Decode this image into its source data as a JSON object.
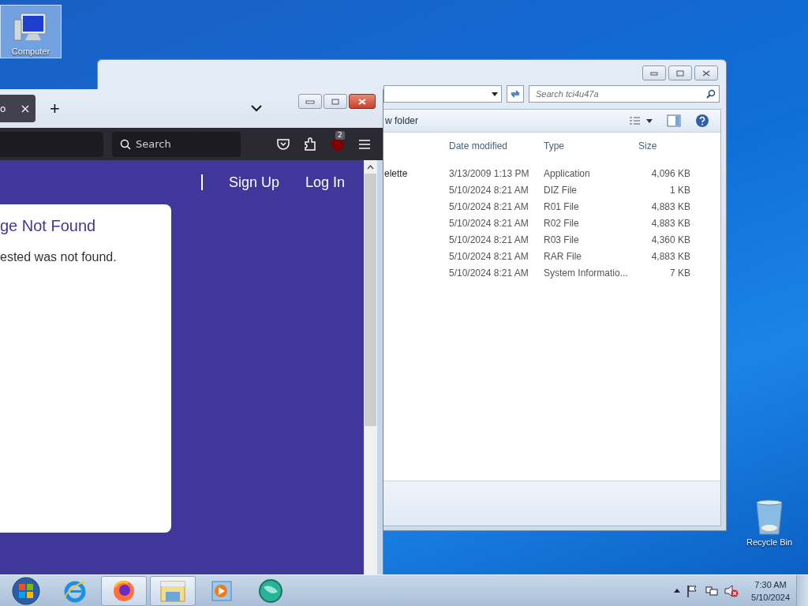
{
  "desktop_icons": [
    {
      "label": "Computer",
      "kind": "computer",
      "selected": true
    },
    {
      "label": "Recycle Bin",
      "kind": "recycle",
      "selected": false
    }
  ],
  "explorer": {
    "search": {
      "placeholder": "Search tci4u47a"
    },
    "toolbar": {
      "new_folder": "w folder"
    },
    "columns": [
      "Date modified",
      "Type",
      "Size"
    ],
    "rows": [
      {
        "name": "elette",
        "date": "3/13/2009 1:13 PM",
        "type": "Application",
        "size": "4,096 KB"
      },
      {
        "date": "5/10/2024 8:21 AM",
        "type": "DIZ File",
        "size": "1 KB"
      },
      {
        "date": "5/10/2024 8:21 AM",
        "type": "R01 File",
        "size": "4,883 KB"
      },
      {
        "date": "5/10/2024 8:21 AM",
        "type": "R02 File",
        "size": "4,883 KB"
      },
      {
        "date": "5/10/2024 8:21 AM",
        "type": "R03 File",
        "size": "4,360 KB"
      },
      {
        "date": "5/10/2024 8:21 AM",
        "type": "RAR File",
        "size": "4,883 KB"
      },
      {
        "date": "5/10/2024 8:21 AM",
        "type": "System Informatio...",
        "size": "7 KB"
      }
    ]
  },
  "browser": {
    "tabs": [
      {
        "title": "o",
        "selected": true
      }
    ],
    "new_tab": "+",
    "search": {
      "placeholder": "Search"
    },
    "addon_badge": "2",
    "nav_links": [
      "Sign Up",
      "Log In"
    ],
    "card": {
      "heading": "ge Not Found",
      "text": "ested was not found."
    }
  },
  "taskbar": {
    "items": [
      {
        "kind": "start",
        "open": false
      },
      {
        "kind": "ie",
        "open": false
      },
      {
        "kind": "firefox",
        "open": true
      },
      {
        "kind": "explorer",
        "open": true
      },
      {
        "kind": "media",
        "open": false
      },
      {
        "kind": "app",
        "open": false
      }
    ],
    "clock": {
      "time": "7:30 AM",
      "date": "5/10/2024"
    }
  }
}
